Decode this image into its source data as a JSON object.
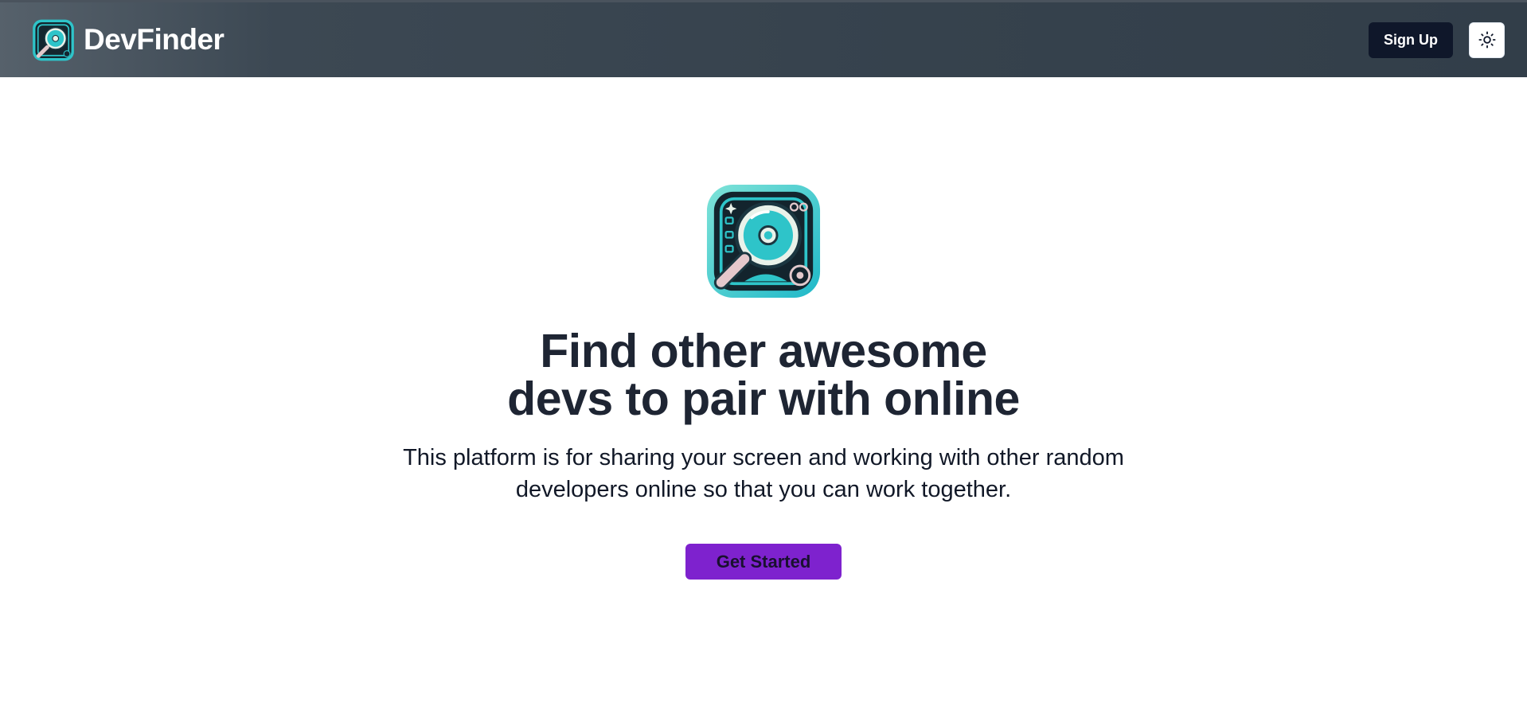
{
  "navbar": {
    "brand_name": "DevFinder",
    "logo_icon": "magnifier-disk-icon",
    "signup_label": "Sign Up",
    "theme_toggle_icon": "sun-icon"
  },
  "hero": {
    "logo_icon": "magnifier-disk-icon",
    "title_line1": "Find other awesome",
    "title_line2": "devs to pair with online",
    "subtitle_line1": "This platform is for sharing your screen and working with other random",
    "subtitle_line2": "developers online so that you can work together.",
    "cta_label": "Get Started"
  },
  "colors": {
    "navbar_bg": "#36424d",
    "signup_bg": "#0f172a",
    "cta_bg": "#7e22ce",
    "logo_accent": "#22c5d0"
  }
}
